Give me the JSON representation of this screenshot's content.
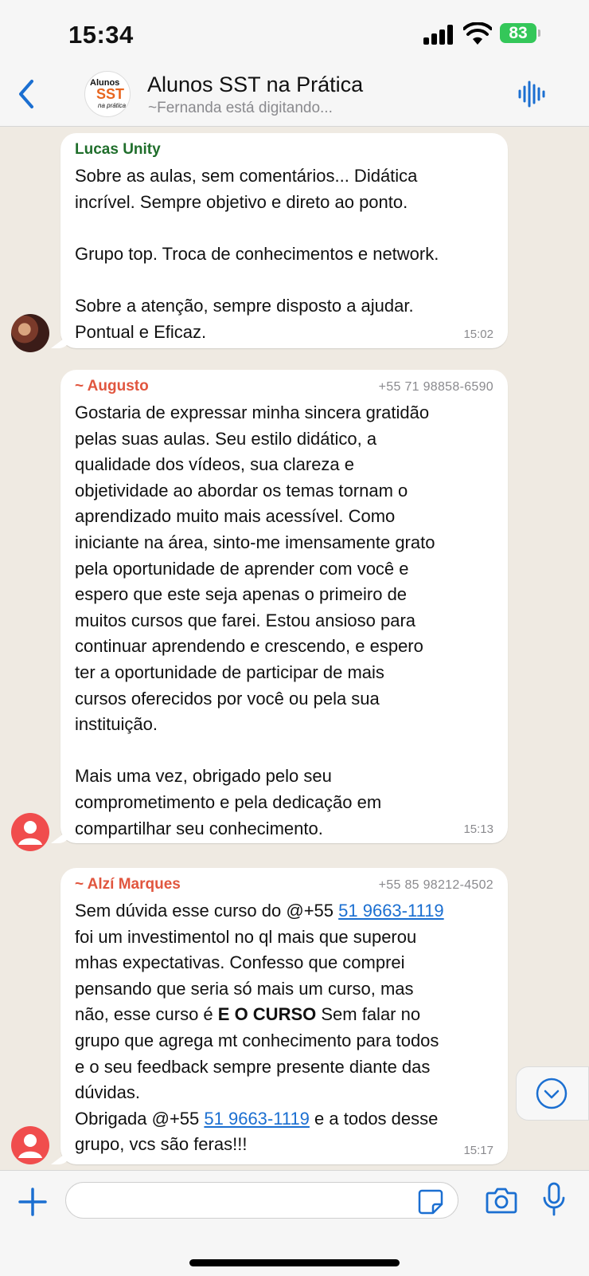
{
  "status": {
    "time": "15:34",
    "battery": "83"
  },
  "header": {
    "title": "Alunos SST na Prática",
    "subtitle": "~Fernanda está digitando...",
    "avatar_text": [
      "Alunos",
      "SST",
      "na prática"
    ]
  },
  "messages": [
    {
      "sender": "Lucas Unity",
      "sender_color": "#1f6e2b",
      "phone": "",
      "text": "Sobre as aulas, sem comentários... Didática\nincrível. Sempre objetivo e direto ao ponto.\n\nGrupo top. Troca de conhecimentos e network.\n\nSobre a atenção, sempre disposto a ajudar.\nPontual e Eficaz.",
      "time": "15:02",
      "avatar": "photo"
    },
    {
      "sender": "~ Augusto",
      "sender_color": "#e1563f",
      "phone": "+55 71 98858-6590",
      "text": "Gostaria de expressar minha sincera gratidão\npelas suas aulas. Seu estilo didático, a\nqualidade dos vídeos, sua clareza e\nobjetividade ao abordar os temas tornam o\naprendizado muito mais acessível. Como\niniciante na área, sinto-me imensamente grato\npela oportunidade de aprender com você e\nespero que este seja apenas o primeiro de\nmuitos cursos que farei. Estou ansioso para\ncontinuar aprendendo e crescendo, e espero\nter a oportunidade de participar de mais\ncursos oferecidos por você ou pela sua\ninstituição.\n\nMais uma vez, obrigado pelo seu\ncomprometimento e pela dedicação em\ncompartilhar seu conhecimento.",
      "time": "15:13",
      "avatar": "default"
    },
    {
      "sender": "~ Alzí Marques",
      "sender_color": "#e1563f",
      "phone": "+55 85 98212-4502",
      "text_parts": {
        "p1": "Sem dúvida esse curso do @+55 ",
        "mention1": "51 9663-1119",
        "p2": "\nfoi um investimentol no ql mais que superou\nmhas expectativas. Confesso que comprei\npensando que seria só mais um curso, mas\nnão, esse curso é ",
        "bold": "E O CURSO",
        "p3": " Sem falar no\ngrupo que agrega mt conhecimento para todos\ne o seu feedback sempre presente diante das\ndúvidas.\nObrigada @+55 ",
        "mention2": "51 9663-1119",
        "p4": " e a todos desse\ngrupo, vcs são feras!!!"
      },
      "time": "15:17",
      "avatar": "default"
    }
  ],
  "input": {
    "placeholder": ""
  },
  "icons": {
    "back": "chevron-left-icon",
    "voice": "voice-waveform-icon",
    "scroll": "chevron-down-icon",
    "plus": "plus-icon",
    "sticker": "sticker-icon",
    "camera": "camera-icon",
    "mic": "microphone-icon"
  },
  "colors": {
    "accent": "#1b6fd1",
    "battery": "#34c759"
  }
}
